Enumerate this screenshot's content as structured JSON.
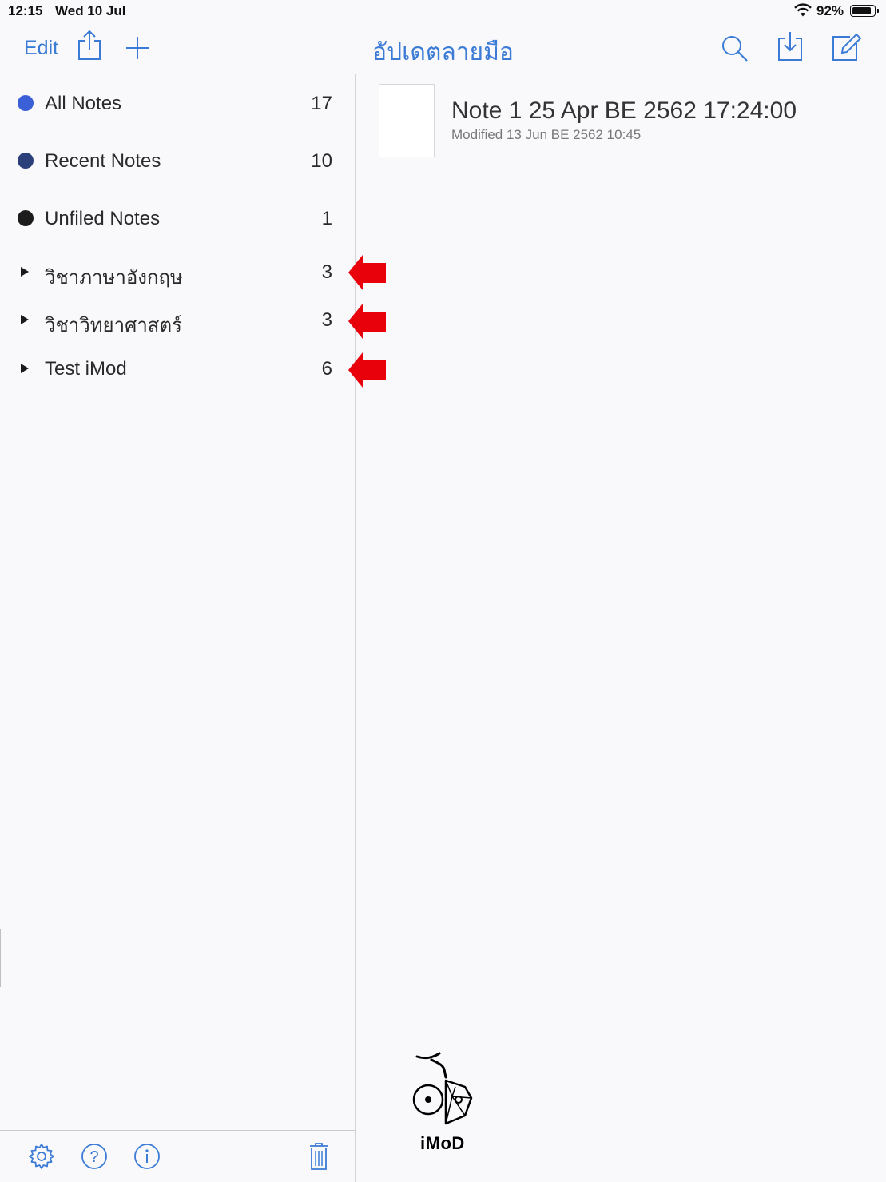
{
  "status_bar": {
    "time": "12:15",
    "date": "Wed 10 Jul",
    "battery_percent": "92%",
    "battery_level": 0.92
  },
  "navbar": {
    "edit_label": "Edit",
    "title": "อัปเดตลายมือ",
    "icons": [
      "share-icon",
      "plus-icon",
      "search-icon",
      "import-icon",
      "compose-icon"
    ]
  },
  "sidebar": {
    "items": [
      {
        "label": "All Notes",
        "count": "17",
        "type": "dot",
        "color": "#3a5fd6"
      },
      {
        "label": "Recent Notes",
        "count": "10",
        "type": "dot",
        "color": "#2b3f7a"
      },
      {
        "label": "Unfiled Notes",
        "count": "1",
        "type": "dot",
        "color": "#1c1c1c"
      },
      {
        "label": "วิชาภาษาอังกฤษ",
        "count": "3",
        "type": "folder"
      },
      {
        "label": "วิชาวิทยาศาสตร์",
        "count": "3",
        "type": "folder"
      },
      {
        "label": "Test iMod",
        "count": "6",
        "type": "folder"
      }
    ]
  },
  "notes": [
    {
      "title": "Note 1 25 Apr BE 2562 17:24:00",
      "modified": "Modified 13 Jun BE 2562 10:45"
    }
  ],
  "toolbar": {
    "icons": [
      "gear-icon",
      "help-icon",
      "info-icon",
      "trash-icon"
    ]
  },
  "watermark": {
    "text": "iMoD"
  },
  "colors": {
    "accent": "#3b7bd6",
    "annotation_arrow": "#e8000b"
  }
}
